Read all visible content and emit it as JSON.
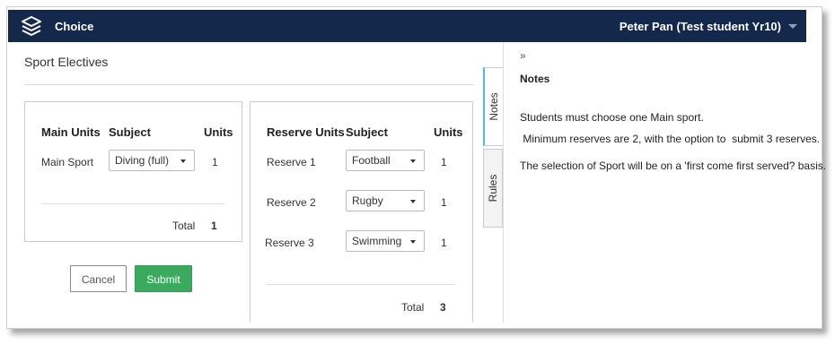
{
  "header": {
    "app_title": "Choice",
    "user": "Peter Pan (Test student Yr10)",
    "logo_icon": "stacked-layers-icon",
    "background": "#13284a"
  },
  "page": {
    "title": "Sport Electives"
  },
  "main_units": {
    "headers": {
      "units_col": "Main Units",
      "subject_col": "Subject",
      "count_col": "Units"
    },
    "rows": [
      {
        "label": "Main Sport",
        "subject": "Diving (full)",
        "units": "1"
      }
    ],
    "total_label": "Total",
    "total_value": "1"
  },
  "reserve_units": {
    "headers": {
      "units_col": "Reserve Units",
      "subject_col": "Subject",
      "count_col": "Units"
    },
    "rows": [
      {
        "label": "Reserve 1",
        "subject": "Football",
        "units": "1"
      },
      {
        "label": "Reserve 2",
        "subject": "Rugby",
        "units": "1"
      },
      {
        "label": "Reserve 3",
        "subject": "Swimming",
        "units": "1"
      }
    ],
    "total_label": "Total",
    "total_value": "3"
  },
  "buttons": {
    "cancel": "Cancel",
    "submit": "Submit",
    "submit_color": "#3caa5e"
  },
  "side_tabs": {
    "notes": "Notes",
    "rules": "Rules",
    "active": "Notes",
    "active_color": "#5bb5d8"
  },
  "notes_panel": {
    "collapse_glyph": "»",
    "title": "Notes",
    "lines": [
      "Students must choose one Main sport.",
      " Minimum reserves are 2, with the option to  submit 3 reserves.",
      "The selection of Sport will be on a 'first come first served? basis."
    ]
  }
}
